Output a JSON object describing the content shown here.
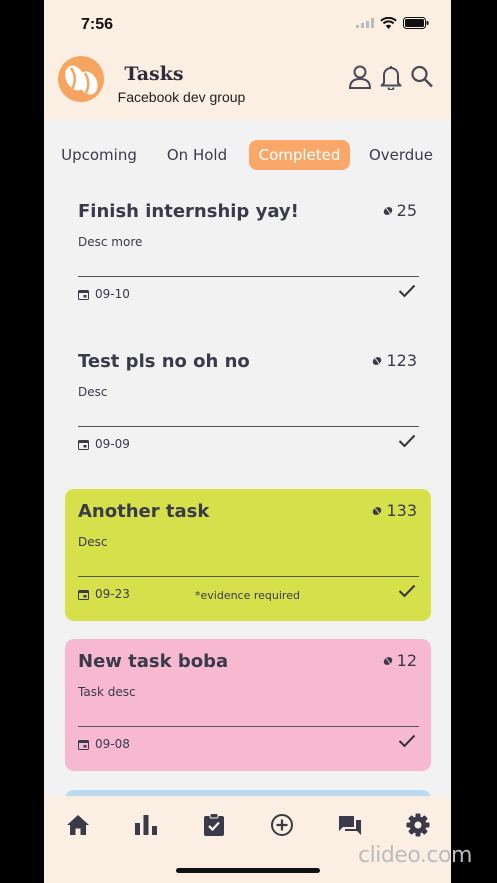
{
  "status": {
    "time": "7:56"
  },
  "header": {
    "title": "Tasks",
    "subtitle": "Facebook dev group"
  },
  "tabs": [
    {
      "label": "Upcoming",
      "active": false
    },
    {
      "label": "On Hold",
      "active": false
    },
    {
      "label": "Completed",
      "active": true
    },
    {
      "label": "Overdue",
      "active": false
    }
  ],
  "tasks": [
    {
      "title": "Finish internship yay!",
      "desc": "Desc more",
      "points": "25",
      "date": "09-10",
      "note": "",
      "color": "#f2f2f2"
    },
    {
      "title": "Test pls no oh no",
      "desc": "Desc",
      "points": "123",
      "date": "09-09",
      "note": "",
      "color": "#f2f2f2"
    },
    {
      "title": "Another task",
      "desc": "Desc",
      "points": "133",
      "date": "09-23",
      "note": "*evidence required",
      "color": "#d5e04a"
    },
    {
      "title": "New task boba",
      "desc": "Task desc",
      "points": "12",
      "date": "09-08",
      "note": "",
      "color": "#f7b9cf"
    }
  ],
  "nav": [
    "home-icon",
    "leaderboard-icon",
    "tasks-clipboard-icon",
    "add-circle-icon",
    "chat-icon",
    "settings-icon"
  ],
  "colors": {
    "accent": "#f9a86a",
    "header_bg": "#faefe2",
    "text": "#3a3a4a"
  },
  "watermark": "clideo.com"
}
